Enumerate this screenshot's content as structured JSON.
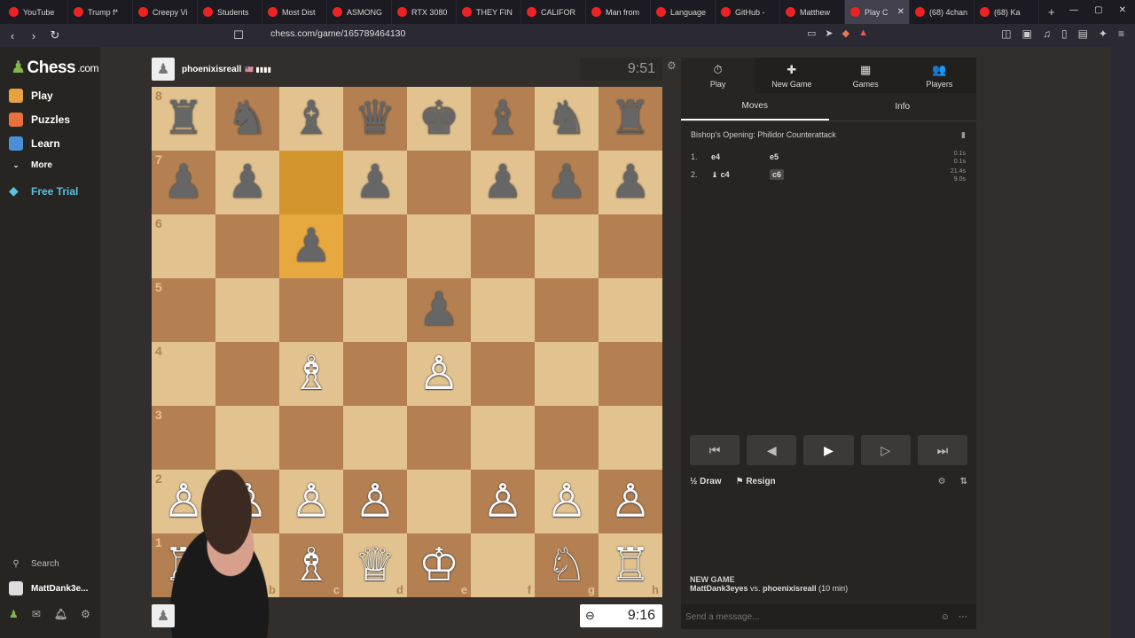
{
  "browser": {
    "tabs": [
      "YouTube",
      "Trump f*",
      "Creepy Vi",
      "Students",
      "Most Dist",
      "ASMONG",
      "RTX 3080",
      "THEY FIN",
      "CALIFOR",
      "Man from",
      "Language",
      "GitHub -",
      "Matthew",
      "Play C",
      "(68) 4chan",
      "(68) Ka"
    ],
    "active_tab": 13,
    "url": "chess.com/game/165789464130"
  },
  "sidebar": {
    "logo": "Chess",
    "logo_suffix": ".com",
    "items": [
      {
        "label": "Play",
        "color": "#e8a040"
      },
      {
        "label": "Puzzles",
        "color": "#e8703a"
      },
      {
        "label": "Learn",
        "color": "#4a90d9"
      },
      {
        "label": "More",
        "color": ""
      },
      {
        "label": "Free Trial",
        "color": "#5bc0de"
      }
    ],
    "search_label": "Search",
    "username": "MattDank3e..."
  },
  "game": {
    "top_player": {
      "name": "phoenixisreall",
      "flag": "🇺🇸 ▮▮▮▮",
      "clock": "9:51"
    },
    "bottom_player": {
      "clock": "9:16"
    },
    "board_ranks": [
      "8",
      "7",
      "6",
      "5",
      "4",
      "3",
      "2",
      "1"
    ],
    "board_files": [
      "a",
      "b",
      "c",
      "d",
      "e",
      "f",
      "g",
      "h"
    ],
    "position": [
      [
        "♜",
        "♞",
        "♝",
        "♛",
        "♚",
        "♝",
        "♞",
        "♜"
      ],
      [
        "♟",
        "♟",
        "",
        "♟",
        "",
        "♟",
        "♟",
        "♟"
      ],
      [
        "",
        "",
        "♟",
        "",
        "",
        "",
        "",
        ""
      ],
      [
        "",
        "",
        "",
        "",
        "♟",
        "",
        "",
        ""
      ],
      [
        "",
        "",
        "♗",
        "",
        "♙",
        "",
        "",
        ""
      ],
      [
        "",
        "",
        "",
        "",
        "",
        "",
        "",
        ""
      ],
      [
        "♙",
        "♙",
        "♙",
        "♙",
        "",
        "♙",
        "♙",
        "♙"
      ],
      [
        "♖",
        "♘",
        "♗",
        "♕",
        "♔",
        "",
        "♘",
        "♖"
      ]
    ],
    "highlighted_squares": [
      "c7",
      "c6"
    ]
  },
  "panel": {
    "tabs": [
      {
        "label": "Play",
        "icon": "⏱"
      },
      {
        "label": "New Game",
        "icon": "✚"
      },
      {
        "label": "Games",
        "icon": "▦"
      },
      {
        "label": "Players",
        "icon": "👥"
      }
    ],
    "subtabs": [
      "Moves",
      "Info"
    ],
    "opening": "Bishop's Opening: Philidor Counterattack",
    "moves": [
      {
        "num": "1.",
        "white": "e4",
        "black": "e5",
        "wt": "0.1s",
        "bt": "0.1s"
      },
      {
        "num": "2.",
        "white": "♝ c4",
        "black": "c6",
        "wt": "21.4s",
        "bt": "9.0s"
      }
    ],
    "draw_label": "Draw",
    "resign_label": "Resign",
    "chat_title": "NEW GAME",
    "chat_white": "MattDank3eyes",
    "chat_vs": "vs.",
    "chat_black": "phoenixisreall",
    "chat_format": "(10 min)",
    "message_placeholder": "Send a message..."
  }
}
